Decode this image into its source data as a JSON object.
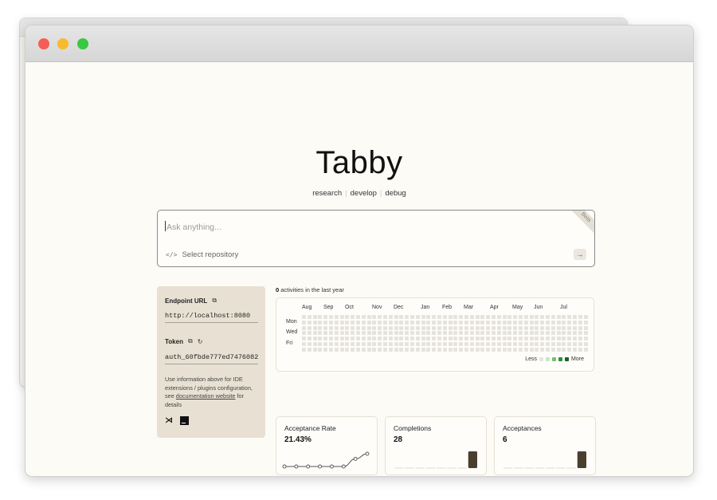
{
  "app": {
    "logo": "Tabby",
    "tagline": [
      "research",
      "develop",
      "debug"
    ]
  },
  "search": {
    "placeholder": "Ask anything...",
    "repo_label": "Select repository",
    "badge": "Beta"
  },
  "endpoint": {
    "url_label": "Endpoint URL",
    "url_value": "http://localhost:8080",
    "token_label": "Token",
    "token_value": "auth_60fbde777ed7476082",
    "help_prefix": "Use information above for IDE extensions / plugins configuration, see ",
    "help_link": "documentation website",
    "help_suffix": " for details"
  },
  "activity": {
    "count": "0",
    "title_suffix": " activities in the last year",
    "months": [
      "Aug",
      "Sep",
      "Oct",
      "Nov",
      "Dec",
      "Jan",
      "Feb",
      "Mar",
      "Apr",
      "May",
      "Jun",
      "Jul"
    ],
    "days": [
      "Mon",
      "Wed",
      "Fri"
    ],
    "legend_less": "Less",
    "legend_more": "More",
    "legend_colors": [
      "#e6e3dd",
      "#c6e7c0",
      "#6fc46a",
      "#2f8f3a",
      "#1f5e27"
    ]
  },
  "stats": {
    "acceptance_rate": {
      "label": "Acceptance Rate",
      "value": "21.43%",
      "points": [
        0,
        0,
        0,
        0,
        0,
        0,
        0.6,
        1
      ]
    },
    "completions": {
      "label": "Completions",
      "value": "28",
      "bars": [
        0,
        0,
        0,
        0,
        0,
        0,
        0,
        1
      ]
    },
    "acceptances": {
      "label": "Acceptances",
      "value": "6",
      "bars": [
        0,
        0,
        0,
        0,
        0,
        0,
        0,
        1
      ]
    }
  },
  "colors": {
    "accent_bar": "#4a3f2e",
    "sidebar_card": "#e8e1d3"
  }
}
